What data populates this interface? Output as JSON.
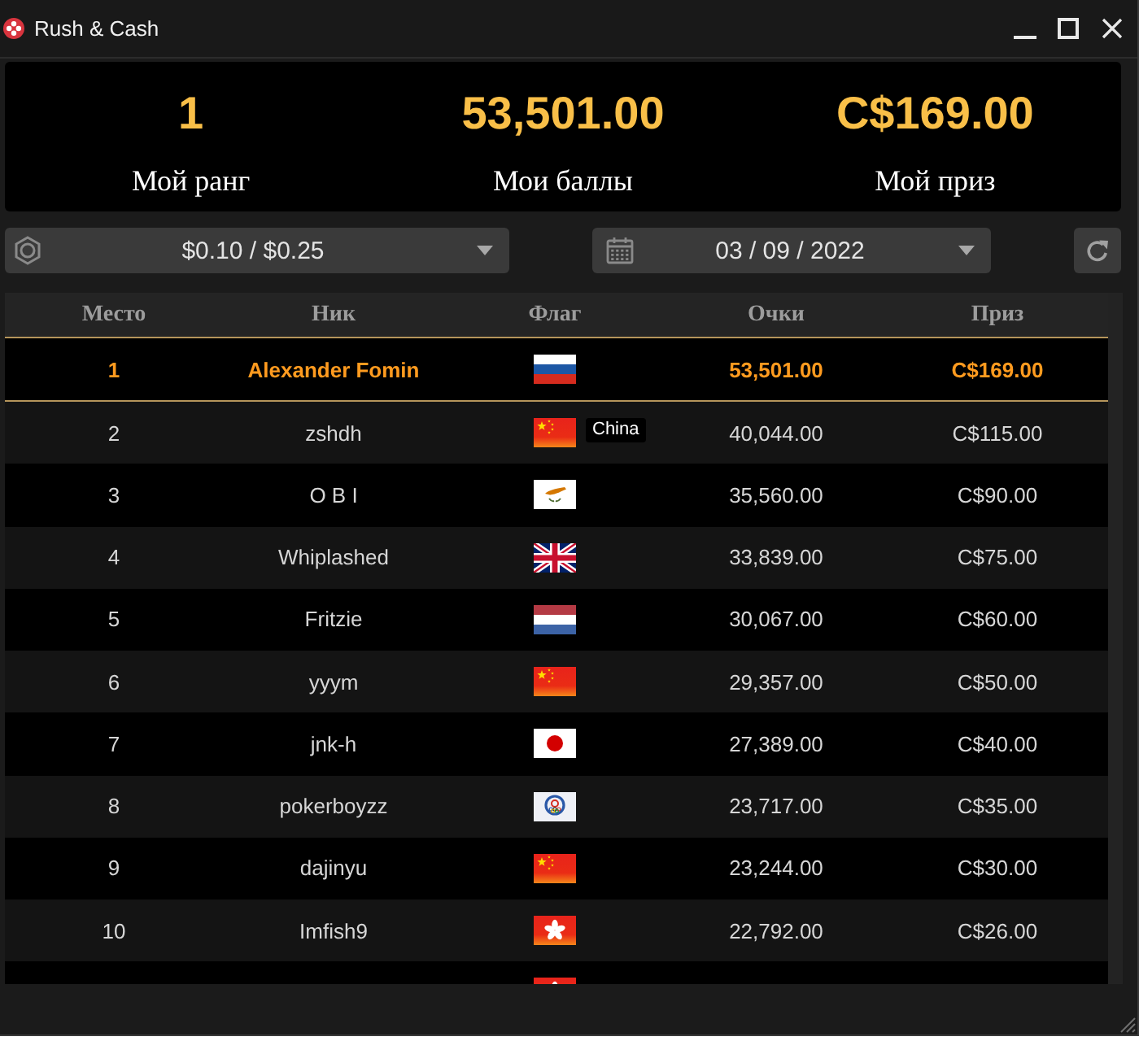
{
  "window": {
    "title": "Rush & Cash"
  },
  "stats": [
    {
      "value": "1",
      "label": "Мой ранг"
    },
    {
      "value": "53,501.00",
      "label": "Мои баллы"
    },
    {
      "value": "C$169.00",
      "label": "Мой приз"
    }
  ],
  "filters": {
    "stakes": {
      "value": "$0.10 / $0.25"
    },
    "date": {
      "value": "03 / 09 / 2022"
    }
  },
  "table": {
    "columns": [
      "Место",
      "Ник",
      "Флаг",
      "Очки",
      "Приз"
    ],
    "rows": [
      {
        "rank": "1",
        "nick": "Alexander Fomin",
        "flag": {
          "kind": "ru"
        },
        "points": "53,501.00",
        "prize": "C$169.00",
        "selected": true
      },
      {
        "rank": "2",
        "nick": "zshdh",
        "flag": {
          "kind": "cn",
          "tooltip": "China"
        },
        "points": "40,044.00",
        "prize": "C$115.00",
        "selected": false
      },
      {
        "rank": "3",
        "nick": "O B I",
        "flag": {
          "kind": "cy"
        },
        "points": "35,560.00",
        "prize": "C$90.00",
        "selected": false
      },
      {
        "rank": "4",
        "nick": "Whiplashed",
        "flag": {
          "kind": "gb"
        },
        "points": "33,839.00",
        "prize": "C$75.00",
        "selected": false
      },
      {
        "rank": "5",
        "nick": "Fritzie",
        "flag": {
          "kind": "nl"
        },
        "points": "30,067.00",
        "prize": "C$60.00",
        "selected": false
      },
      {
        "rank": "6",
        "nick": "yyym",
        "flag": {
          "kind": "cn"
        },
        "points": "29,357.00",
        "prize": "C$50.00",
        "selected": false
      },
      {
        "rank": "7",
        "nick": "jnk-h",
        "flag": {
          "kind": "jp"
        },
        "points": "27,389.00",
        "prize": "C$40.00",
        "selected": false
      },
      {
        "rank": "8",
        "nick": "pokerboyzz",
        "flag": {
          "kind": "tw"
        },
        "points": "23,717.00",
        "prize": "C$35.00",
        "selected": false
      },
      {
        "rank": "9",
        "nick": "dajinyu",
        "flag": {
          "kind": "cn"
        },
        "points": "23,244.00",
        "prize": "C$30.00",
        "selected": false
      },
      {
        "rank": "10",
        "nick": "Imfish9",
        "flag": {
          "kind": "hk"
        },
        "points": "22,792.00",
        "prize": "C$26.00",
        "selected": false
      },
      {
        "flag": {
          "kind": "hk"
        },
        "selected": false
      }
    ]
  }
}
